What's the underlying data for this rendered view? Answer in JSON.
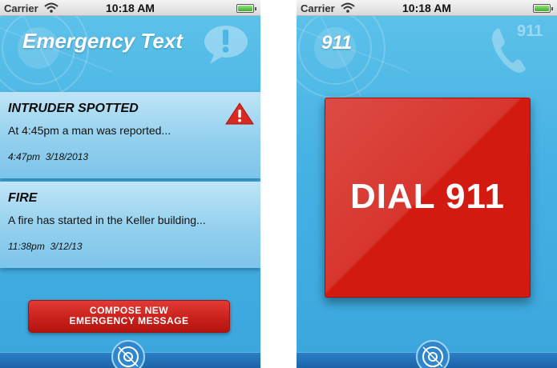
{
  "status_bar": {
    "carrier": "Carrier",
    "time": "10:18 AM",
    "icons": [
      "wifi-icon",
      "battery-icon"
    ]
  },
  "left_screen": {
    "title": "Emergency Text",
    "header_icon": "speech-bubble-exclamation-icon",
    "messages": [
      {
        "title": "INTRUDER SPOTTED",
        "body": "At 4:45pm a man was reported...",
        "time": "4:47pm  3/18/2013",
        "icon": "warning-icon"
      },
      {
        "title": "FIRE",
        "body": "A fire has started in the Keller building...",
        "time": "11:38pm  3/12/13"
      }
    ],
    "compose_button": {
      "line1": "COMPOSE NEW",
      "line2": "EMERGENCY MESSAGE"
    },
    "nav_icon": "target-icon"
  },
  "right_screen": {
    "title": "911",
    "corner_label": "911",
    "header_icon": "phone-icon",
    "dial_button_label": "DIAL 911",
    "nav_icon": "target-icon"
  },
  "colors": {
    "background_blue": "#46b1e3",
    "card_blue": "#93d0ee",
    "button_red": "#d21a10",
    "bottom_bar": "#1c63a8"
  }
}
